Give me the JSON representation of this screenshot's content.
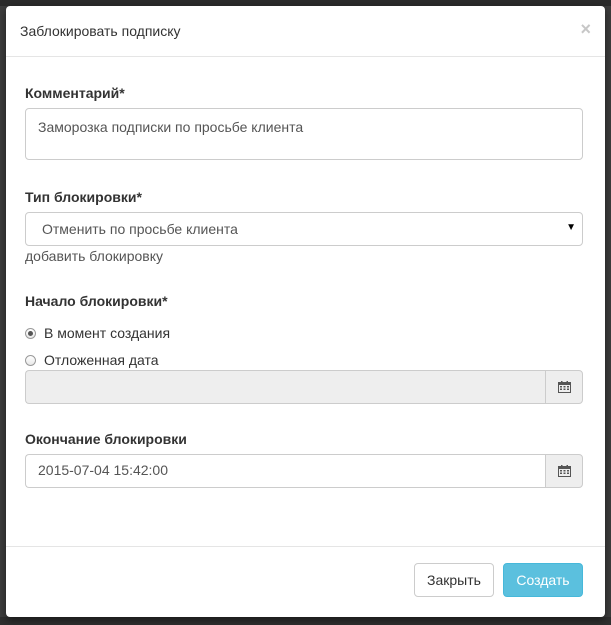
{
  "modal": {
    "title": "Заблокировать подписку",
    "close_glyph": "×"
  },
  "comment": {
    "label": "Комментарий*",
    "value": "Заморозка подписки по просьбе клиента"
  },
  "block_type": {
    "label": "Тип блокировки*",
    "selected": "Отменить по просьбе клиента",
    "add_link": "добавить блокировку"
  },
  "block_start": {
    "label": "Начало блокировки*",
    "options": [
      {
        "label": "В момент создания",
        "checked": true
      },
      {
        "label": "Отложенная дата",
        "checked": false
      }
    ],
    "date_value": ""
  },
  "block_end": {
    "label": "Окончание блокировки",
    "date_value": "2015-07-04 15:42:00"
  },
  "footer": {
    "close_label": "Закрыть",
    "create_label": "Создать"
  },
  "colors": {
    "primary": "#5bc0de",
    "backdrop": "#3d3d3d"
  }
}
